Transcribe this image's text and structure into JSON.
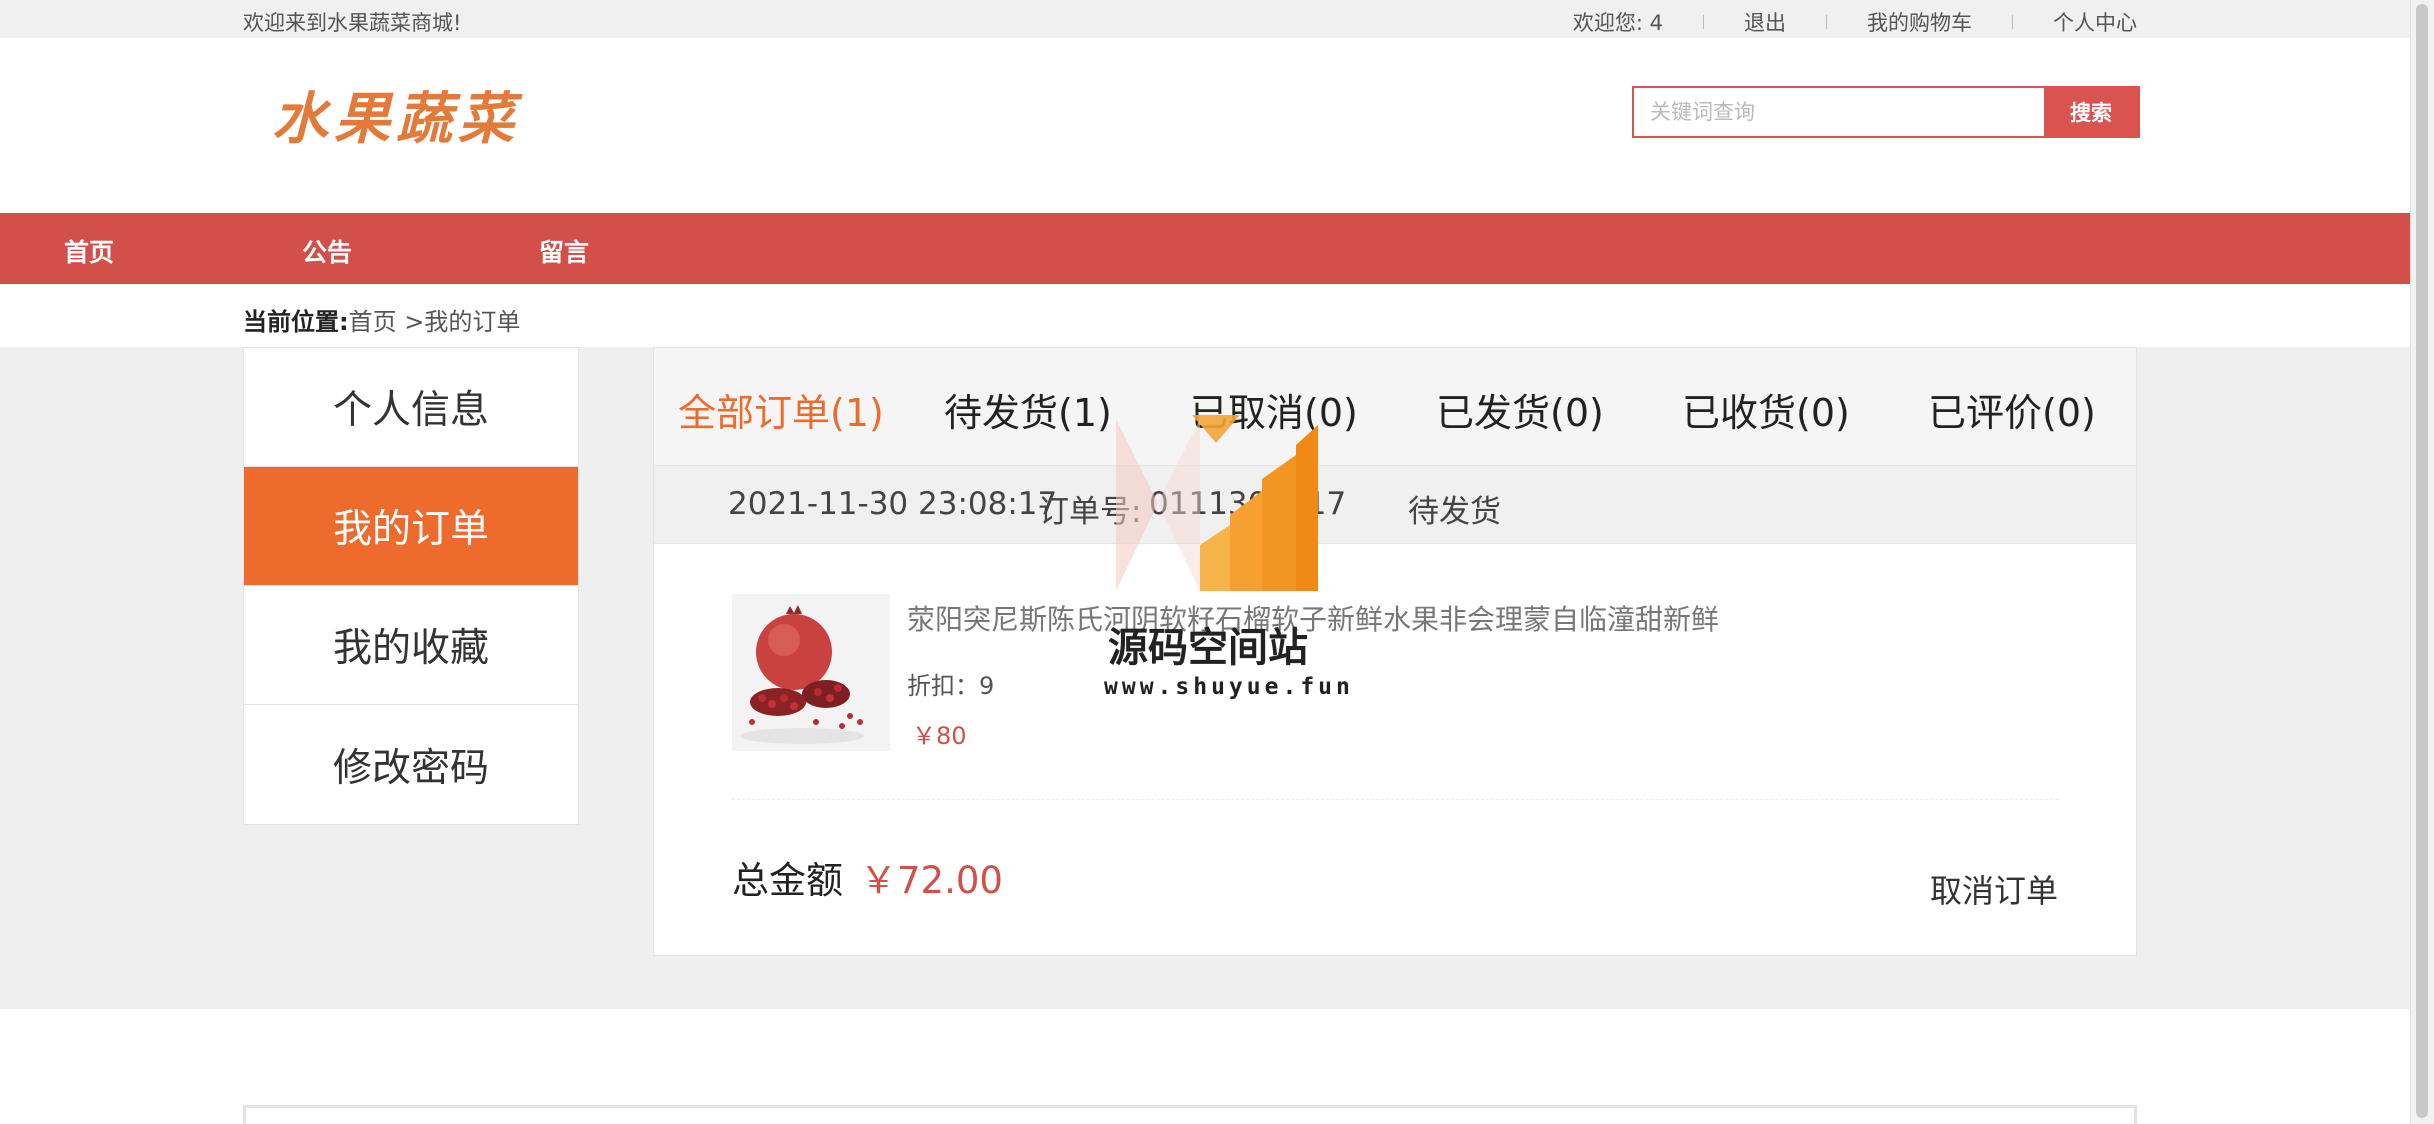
{
  "topbar": {
    "welcome_text": "欢迎来到水果蔬菜商城!",
    "user_label": "欢迎您: 4",
    "logout_label": "退出",
    "cart_label": "我的购物车",
    "profile_label": "个人中心"
  },
  "header": {
    "logo_text": "水果蔬菜",
    "search_placeholder": "关键词查询",
    "search_button": "搜索"
  },
  "nav": {
    "items": [
      {
        "label": "首页"
      },
      {
        "label": "公告"
      },
      {
        "label": "留言"
      }
    ]
  },
  "breadcrumb": {
    "prefix": "当前位置:",
    "path": "首页 >我的订单"
  },
  "sidebar": {
    "items": [
      {
        "label": "个人信息",
        "active": false
      },
      {
        "label": "我的订单",
        "active": true
      },
      {
        "label": "我的收藏",
        "active": false
      },
      {
        "label": "修改密码",
        "active": false
      }
    ]
  },
  "order_tabs": [
    {
      "label": "全部订单(1)",
      "active": true
    },
    {
      "label": "待发货(1)",
      "active": false
    },
    {
      "label": "已取消(0)",
      "active": false
    },
    {
      "label": "已发货(0)",
      "active": false
    },
    {
      "label": "已收货(0)",
      "active": false
    },
    {
      "label": "已评价(0)",
      "active": false
    }
  ],
  "order": {
    "date": "2021-11-30 23:08:17",
    "number_label": "订单号:",
    "number": "0111302817",
    "status": "待发货",
    "product": {
      "name": "荥阳突尼斯陈氏河阴软籽石榴软子新鲜水果非会理蒙自临潼甜新鲜",
      "discount": "折扣：9",
      "price": "￥80",
      "image": "pomegranate-photo"
    },
    "total_label": "总金额",
    "total_value": "￥72.00",
    "cancel_label": "取消订单"
  },
  "watermark": {
    "title": "源码空间站",
    "url": "www.shuyue.fun"
  },
  "colors": {
    "nav_red": "#d24f4a",
    "accent_orange": "#ec6b2d",
    "price_red": "#d24f4a"
  }
}
